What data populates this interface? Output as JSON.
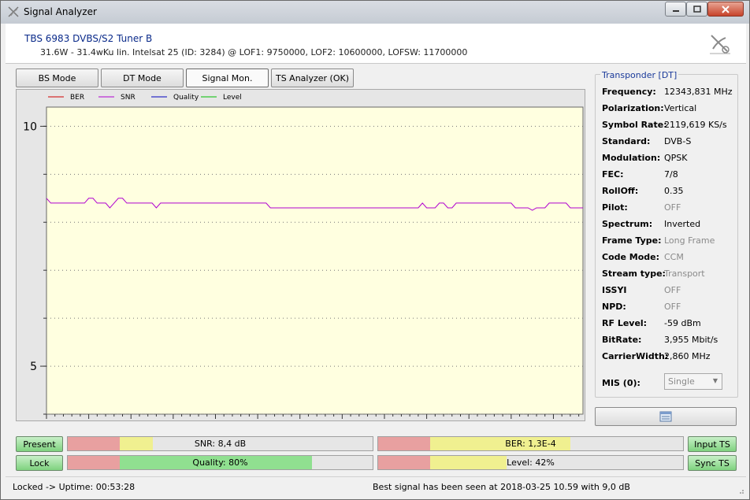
{
  "window": {
    "title": "Signal Analyzer"
  },
  "header": {
    "tuner": "TBS 6983 DVBS/S2 Tuner B",
    "satellite": "31.6W - 31.4wKu lin. Intelsat 25 (ID: 3284) @ LOF1: 9750000, LOF2: 10600000, LOFSW: 11700000"
  },
  "tabs": [
    {
      "label": "BS Mode"
    },
    {
      "label": "DT Mode"
    },
    {
      "label": "Signal Mon."
    },
    {
      "label": "TS Analyzer (OK)"
    }
  ],
  "chart_data": {
    "type": "line",
    "legend": [
      {
        "name": "BER",
        "color": "#d00000"
      },
      {
        "name": "SNR",
        "color": "#b000d0"
      },
      {
        "name": "Quality",
        "color": "#0000c0"
      },
      {
        "name": "Level",
        "color": "#00c000"
      }
    ],
    "yticks": [
      "10",
      "5"
    ],
    "ylim": [
      4.0,
      10.4
    ],
    "grid": true,
    "background": "#ffffe0",
    "series": [
      {
        "name": "SNR",
        "values": [
          8.5,
          8.4,
          8.4,
          8.4,
          8.4,
          8.4,
          8.4,
          8.4,
          8.4,
          8.4,
          8.5,
          8.5,
          8.4,
          8.4,
          8.4,
          8.3,
          8.4,
          8.5,
          8.5,
          8.4,
          8.4,
          8.4,
          8.4,
          8.4,
          8.4,
          8.4,
          8.3,
          8.4,
          8.4,
          8.4,
          8.4,
          8.4,
          8.4,
          8.4,
          8.4,
          8.4,
          8.4,
          8.4,
          8.4,
          8.4,
          8.4,
          8.4,
          8.4,
          8.4,
          8.4,
          8.4,
          8.4,
          8.4,
          8.4,
          8.4,
          8.4,
          8.4,
          8.4,
          8.3,
          8.3,
          8.3,
          8.3,
          8.3,
          8.3,
          8.3,
          8.3,
          8.3,
          8.3,
          8.3,
          8.3,
          8.3,
          8.3,
          8.3,
          8.3,
          8.3,
          8.3,
          8.3,
          8.3,
          8.3,
          8.3,
          8.3,
          8.3,
          8.3,
          8.3,
          8.3,
          8.3,
          8.3,
          8.3,
          8.3,
          8.3,
          8.3,
          8.3,
          8.3,
          8.3,
          8.4,
          8.3,
          8.3,
          8.3,
          8.4,
          8.4,
          8.3,
          8.3,
          8.4,
          8.4,
          8.4,
          8.4,
          8.4,
          8.4,
          8.4,
          8.4,
          8.4,
          8.4,
          8.4,
          8.4,
          8.4,
          8.4,
          8.3,
          8.3,
          8.3,
          8.3,
          8.25,
          8.3,
          8.3,
          8.3,
          8.4,
          8.4,
          8.4,
          8.4,
          8.4,
          8.3,
          8.3,
          8.3,
          8.3
        ]
      }
    ]
  },
  "transponder": {
    "title": "Transponder [DT]",
    "rows": [
      {
        "label": "Frequency:",
        "value": "12343,831 MHz"
      },
      {
        "label": "Polarization:",
        "value": "Vertical"
      },
      {
        "label": "Symbol Rate:",
        "value": "2119,619 KS/s"
      },
      {
        "label": "Standard:",
        "value": "DVB-S"
      },
      {
        "label": "Modulation:",
        "value": "QPSK"
      },
      {
        "label": "FEC:",
        "value": "7/8"
      },
      {
        "label": "RollOff:",
        "value": "0.35"
      },
      {
        "label": "Pilot:",
        "value": "OFF",
        "dim": true
      },
      {
        "label": "Spectrum:",
        "value": "Inverted"
      },
      {
        "label": "Frame Type:",
        "value": "Long Frame",
        "dim": true
      },
      {
        "label": "Code Mode:",
        "value": "CCM",
        "dim": true
      },
      {
        "label": "Stream type:",
        "value": "Transport",
        "dim": true
      },
      {
        "label": "ISSYI",
        "value": "OFF",
        "dim": true
      },
      {
        "label": "NPD:",
        "value": "OFF",
        "dim": true
      },
      {
        "label": "RF Level:",
        "value": "-59 dBm"
      },
      {
        "label": "BitRate:",
        "value": "3,955 Mbit/s"
      },
      {
        "label": "CarrierWidth:",
        "value": "2,860 MHz"
      }
    ],
    "mis_label": "MIS (0):",
    "mis_value": "Single"
  },
  "indicators": {
    "present": "Present",
    "lock": "Lock",
    "input_ts": "Input TS",
    "sync_ts": "Sync TS"
  },
  "meters": {
    "snr": {
      "label": "SNR: 8,4 dB",
      "fill": 0.28
    },
    "ber": {
      "label": "BER: 1,3E-4",
      "fill": 0.63
    },
    "quality": {
      "label": "Quality: 80%",
      "fill": 0.8
    },
    "level": {
      "label": "Level: 42%",
      "fill": 0.42
    }
  },
  "status": {
    "left": "Locked -> Uptime: 00:53:28",
    "middle": "Best signal has been seen at 2018-03-25 10.59 with 9,0 dB"
  },
  "colors": {
    "meter_red": "#e8a0a0",
    "meter_yellow": "#f0f090",
    "meter_green": "#90e090",
    "indicator_green": "#7fd27f"
  }
}
